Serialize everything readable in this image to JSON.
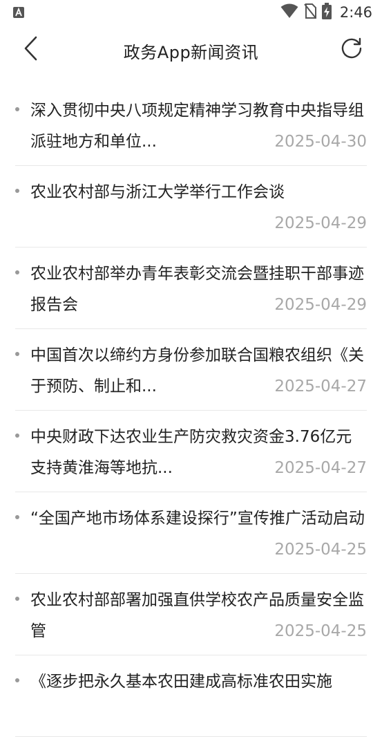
{
  "status_bar": {
    "time": "2:46",
    "left_icon": "a-notification-icon",
    "icons": [
      "wifi-icon",
      "no-sim-icon",
      "battery-charging-icon"
    ]
  },
  "app_bar": {
    "title": "政务App新闻资讯",
    "back_icon": "chevron-left-icon",
    "refresh_icon": "refresh-icon"
  },
  "news": [
    {
      "title": "深入贯彻中央八项规定精神学习教育中央指导组派驻地方和单位...",
      "date": "2025-04-30"
    },
    {
      "title": "农业农村部与浙江大学举行工作会谈",
      "date": "2025-04-29"
    },
    {
      "title": "农业农村部举办青年表彰交流会暨挂职干部事迹报告会",
      "date": "2025-04-29"
    },
    {
      "title": "中国首次以缔约方身份参加联合国粮农组织《关于预防、制止和...",
      "date": "2025-04-27"
    },
    {
      "title": "中央财政下达农业生产防灾救灾资金3.76亿元 支持黄淮海等地抗...",
      "date": "2025-04-27"
    },
    {
      "title": "“全国产地市场体系建设探行”宣传推广活动启动",
      "date": "2025-04-25"
    },
    {
      "title": "农业农村部部署加强直供学校农产品质量安全监管",
      "date": "2025-04-25"
    },
    {
      "title": "《逐步把永久基本农田建成高标准农田实施",
      "date": ""
    }
  ]
}
